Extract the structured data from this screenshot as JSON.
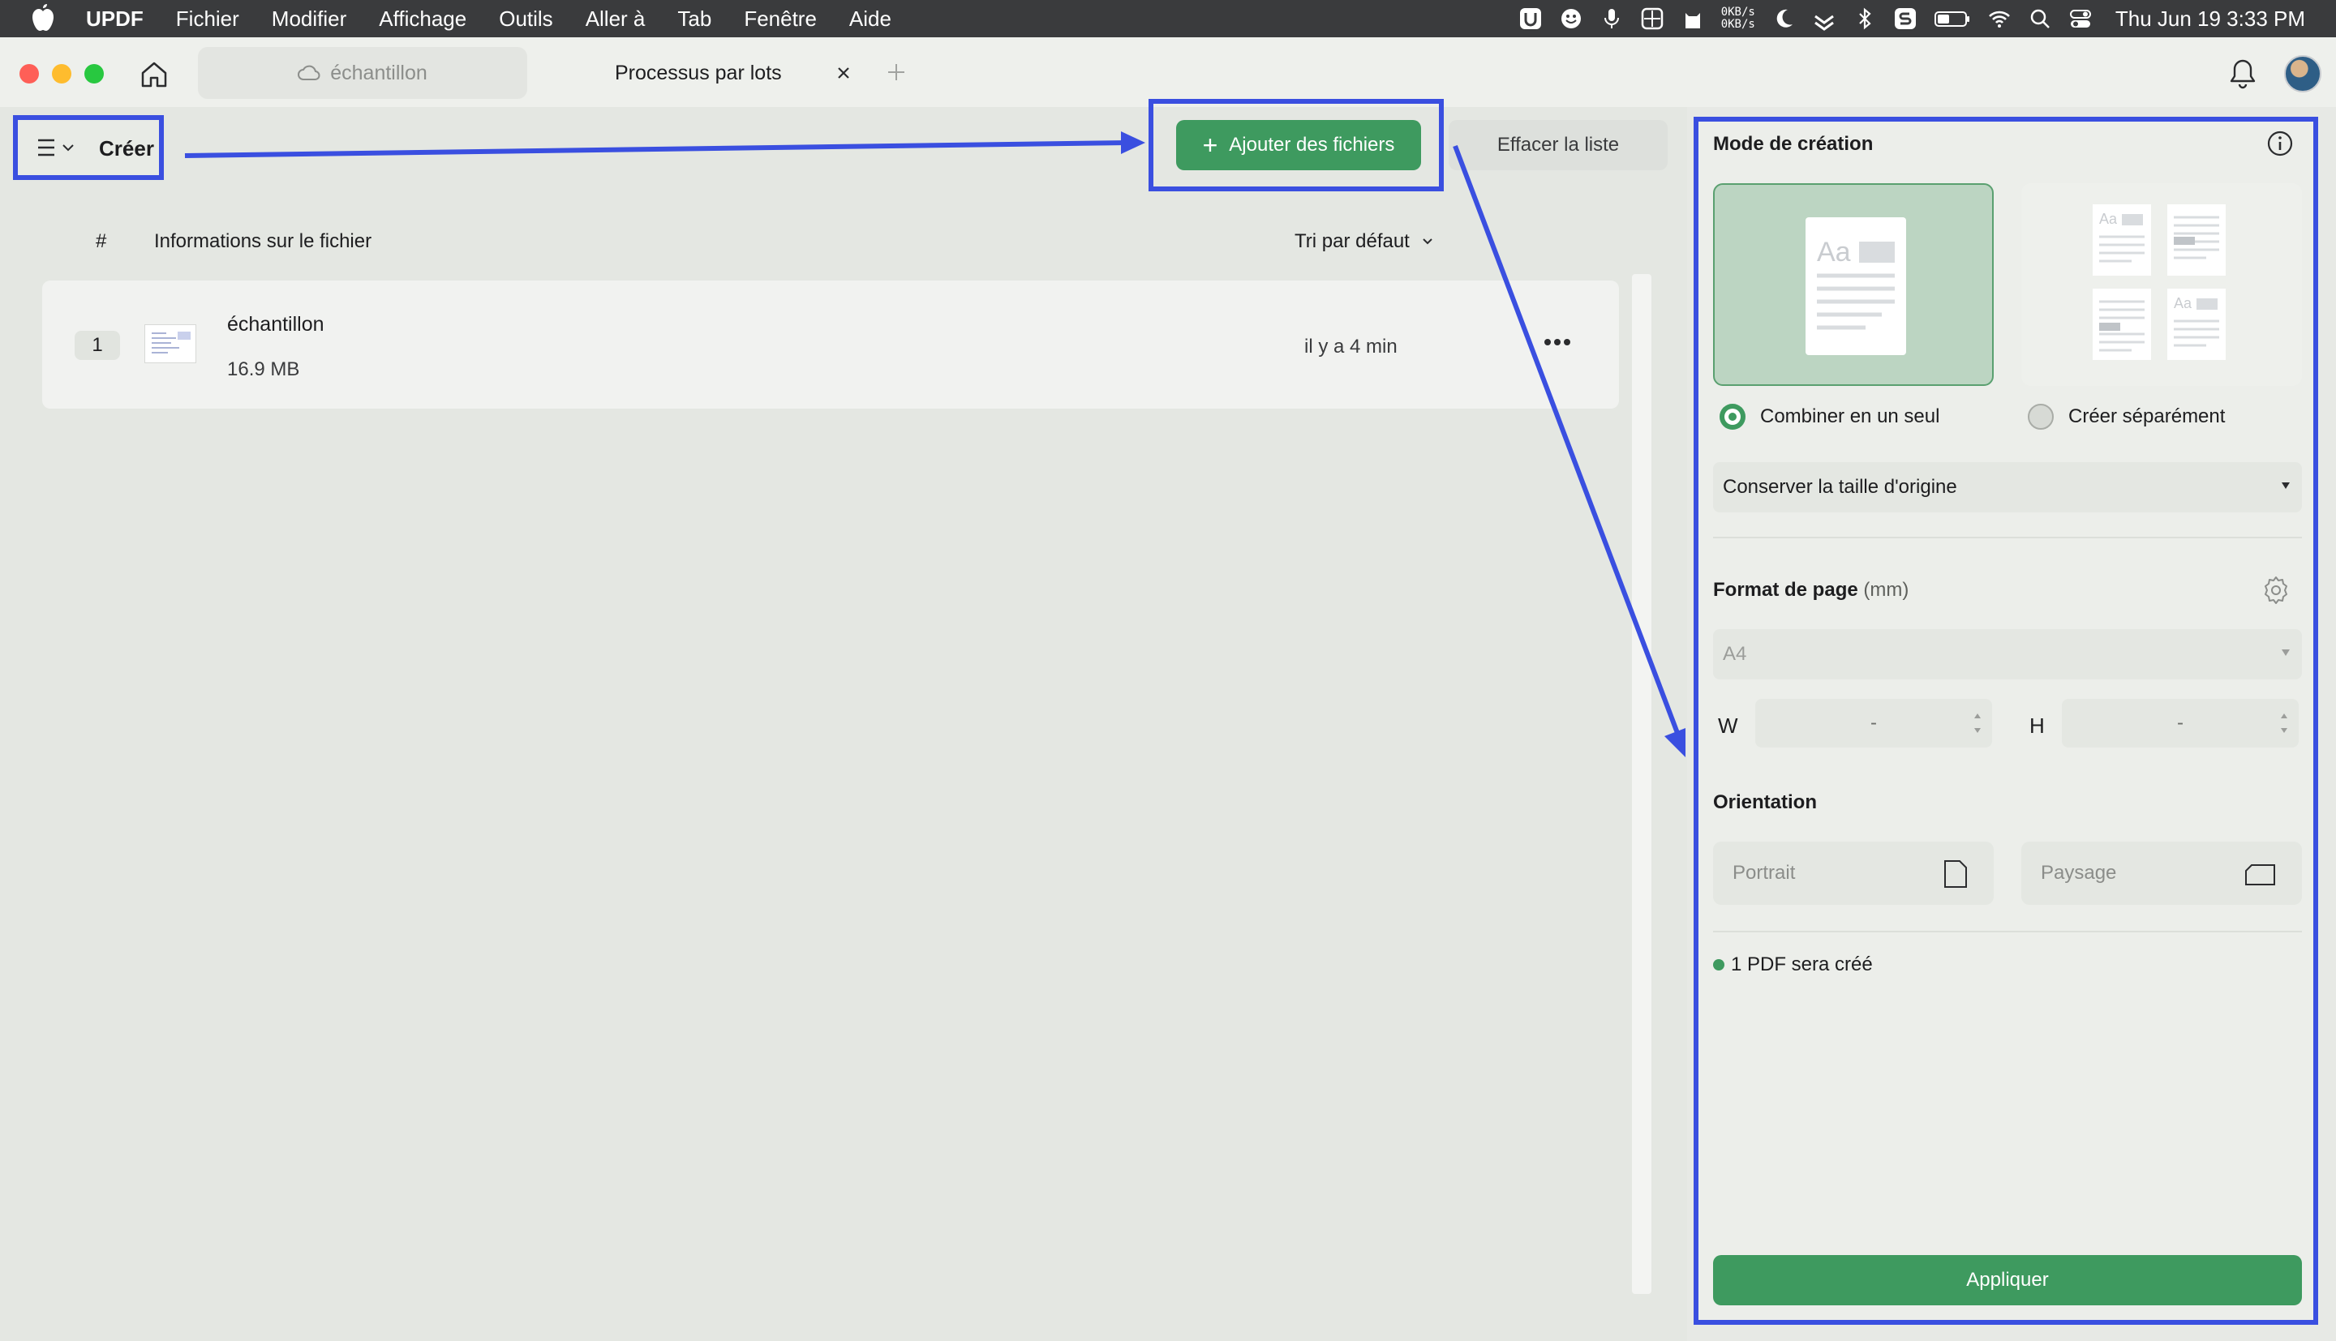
{
  "menubar": {
    "app_name": "UPDF",
    "items": [
      "Fichier",
      "Modifier",
      "Affichage",
      "Outils",
      "Aller à",
      "Tab",
      "Fenêtre",
      "Aide"
    ],
    "net_up": "0KB/s",
    "net_down": "0KB/s",
    "datetime": "Thu Jun 19  3:33 PM"
  },
  "tabs": [
    {
      "label": "échantillon",
      "active": false
    },
    {
      "label": "Processus par lots",
      "active": true
    }
  ],
  "toolbar": {
    "mode_label": "Créer",
    "add_files_label": "Ajouter des fichiers",
    "clear_list_label": "Effacer la liste"
  },
  "list": {
    "col_number": "#",
    "col_info": "Informations sur le fichier",
    "sort_label": "Tri par défaut",
    "rows": [
      {
        "index": "1",
        "name": "échantillon",
        "size": "16.9 MB",
        "time": "il y a 4 min"
      }
    ]
  },
  "panel": {
    "title": "Mode de création",
    "option_combine": "Combiner en un seul",
    "option_separate": "Créer séparément",
    "selected_option": "combine",
    "size_select_value": "Conserver la taille d'origine",
    "page_format_label": "Format de page",
    "page_format_unit": "(mm)",
    "page_format_value": "A4",
    "width_label": "W",
    "height_label": "H",
    "width_value": "-",
    "height_value": "-",
    "orientation_label": "Orientation",
    "portrait_label": "Portrait",
    "landscape_label": "Paysage",
    "status_text": "1 PDF sera créé",
    "apply_label": "Appliquer"
  },
  "colors": {
    "accent_green": "#3e9a5f",
    "annotation_blue": "#3a4fe0"
  }
}
